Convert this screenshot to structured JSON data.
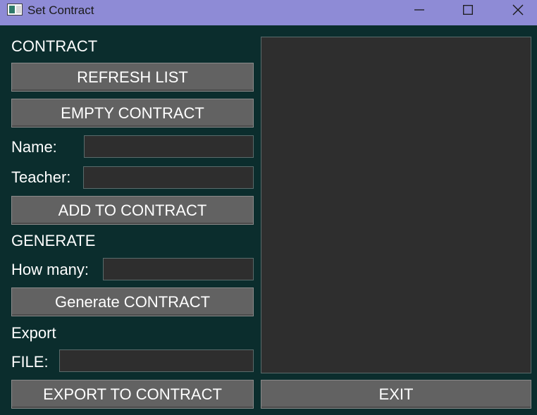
{
  "window": {
    "title": "Set Contract"
  },
  "contract_section": {
    "heading": "CONTRACT",
    "refresh_label": "REFRESH LIST",
    "empty_label": "EMPTY CONTRACT",
    "name_label": "Name:",
    "name_value": "",
    "teacher_label": "Teacher:",
    "teacher_value": "",
    "add_label": "ADD TO CONTRACT"
  },
  "generate_section": {
    "heading": "GENERATE",
    "how_many_label": "How many:",
    "how_many_value": "",
    "generate_label": "Generate CONTRACT"
  },
  "export_section": {
    "heading": "Export",
    "file_label": "FILE:",
    "file_value": "",
    "export_label": "EXPORT TO CONTRACT"
  },
  "footer": {
    "exit_label": "EXIT"
  },
  "icons": {
    "app": "app-window-icon",
    "minimize": "minimize-icon",
    "maximize": "maximize-icon",
    "close": "close-icon"
  },
  "colors": {
    "background": "#0b2d2d",
    "titlebar": "#8e8bd6",
    "button": "#626262",
    "field": "#2e2e2e"
  }
}
